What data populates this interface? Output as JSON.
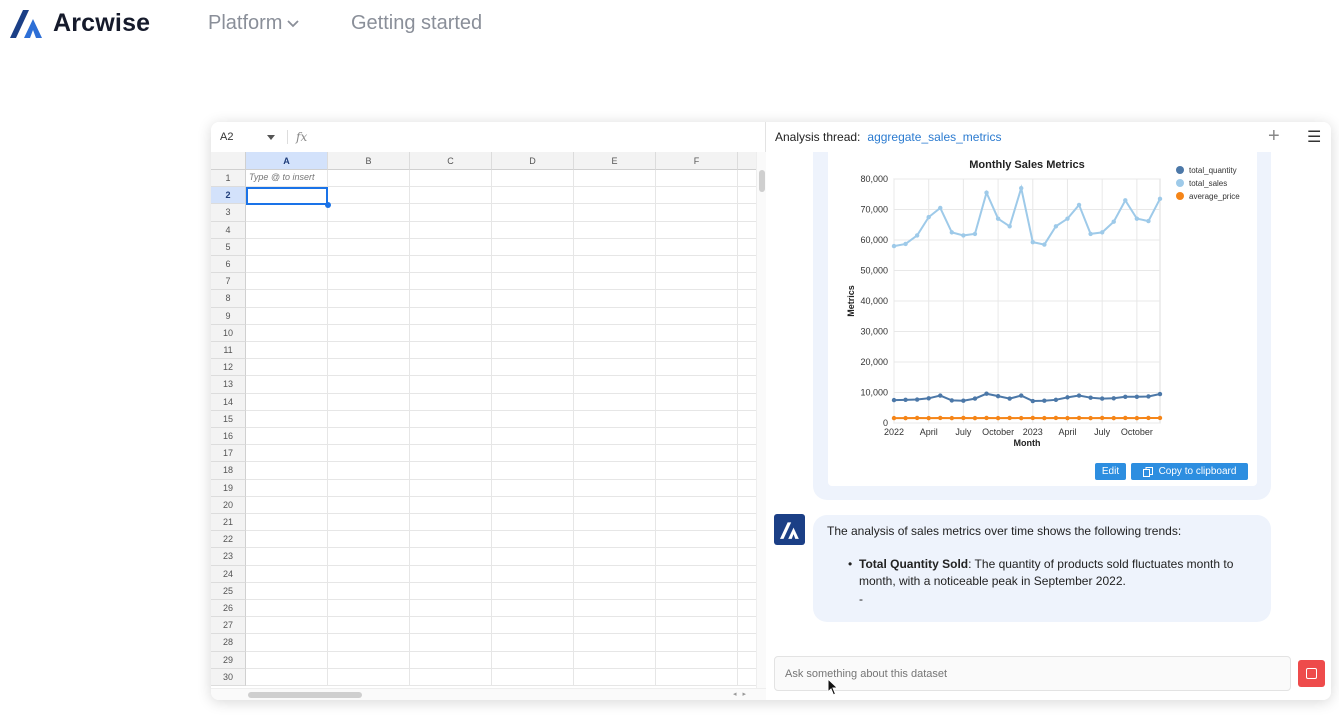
{
  "nav": {
    "brand": "Arcwise",
    "links": [
      {
        "label": "Platform",
        "has_dropdown": true
      },
      {
        "label": "Getting started",
        "has_dropdown": false
      }
    ]
  },
  "sheet": {
    "cell_ref": "A2",
    "fx_label": "fx",
    "columns": [
      "A",
      "B",
      "C",
      "D",
      "E",
      "F"
    ],
    "rows": [
      "1",
      "2",
      "3",
      "4",
      "5",
      "6",
      "7",
      "8",
      "9",
      "10",
      "11",
      "12",
      "13",
      "14",
      "15",
      "16",
      "17",
      "18",
      "19",
      "20",
      "21",
      "22",
      "23",
      "24",
      "25",
      "26",
      "27",
      "28",
      "29",
      "30"
    ],
    "active_column": "A",
    "active_row": "2",
    "cell_a1_placeholder": "Type @ to insert"
  },
  "thread": {
    "label": "Analysis thread:",
    "name": "aggregate_sales_metrics",
    "plus_icon": "plus-icon",
    "menu_icon": "hamburger-menu-icon"
  },
  "chart_actions": {
    "edit_label": "Edit",
    "copy_label": "Copy to clipboard"
  },
  "message": {
    "intro": "The analysis of sales metrics over time shows the following trends:",
    "bullet_bold": "Total Quantity Sold",
    "bullet_text": ": The quantity of products sold fluctuates month to month, with a noticeable peak in September 2022.",
    "trailing": "-"
  },
  "input": {
    "placeholder": "Ask something about this dataset"
  },
  "colors": {
    "total_quantity": "#4c78a8",
    "total_sales": "#9ecae9",
    "average_price": "#f58518",
    "accent": "#2d8ee0",
    "stop": "#ee4b4b"
  },
  "chart_data": {
    "type": "line",
    "title": "Monthly Sales Metrics",
    "xlabel": "Month",
    "ylabel": "Metrics",
    "ylim": [
      0,
      80000
    ],
    "yticks": [
      "0",
      "10,000",
      "20,000",
      "30,000",
      "40,000",
      "50,000",
      "60,000",
      "70,000",
      "80,000"
    ],
    "xticks": [
      "2022",
      "April",
      "July",
      "October",
      "2023",
      "April",
      "July",
      "October"
    ],
    "grid": true,
    "legend_position": "top-right",
    "x": [
      "2022-01",
      "2022-02",
      "2022-03",
      "2022-04",
      "2022-05",
      "2022-06",
      "2022-07",
      "2022-08",
      "2022-09",
      "2022-10",
      "2022-11",
      "2022-12",
      "2023-01",
      "2023-02",
      "2023-03",
      "2023-04",
      "2023-05",
      "2023-06",
      "2023-07",
      "2023-08",
      "2023-09",
      "2023-10",
      "2023-11",
      "2023-12"
    ],
    "series": [
      {
        "name": "total_quantity",
        "values": [
          7500,
          7600,
          7700,
          8100,
          9000,
          7400,
          7300,
          8000,
          9600,
          8800,
          8000,
          9000,
          7200,
          7300,
          7600,
          8400,
          9000,
          8300,
          8000,
          8100,
          8600,
          8600,
          8700,
          9500
        ]
      },
      {
        "name": "total_sales",
        "values": [
          58000,
          58700,
          61500,
          67500,
          70500,
          62500,
          61500,
          62000,
          75500,
          67000,
          64500,
          77000,
          59300,
          58500,
          64500,
          67000,
          71500,
          62000,
          62500,
          66000,
          73000,
          67000,
          66200,
          73500
        ]
      },
      {
        "name": "average_price",
        "values": [
          1600,
          1600,
          1650,
          1600,
          1650,
          1600,
          1650,
          1600,
          1650,
          1600,
          1650,
          1600,
          1650,
          1600,
          1650,
          1600,
          1650,
          1600,
          1650,
          1600,
          1650,
          1600,
          1650,
          1650
        ]
      }
    ]
  }
}
